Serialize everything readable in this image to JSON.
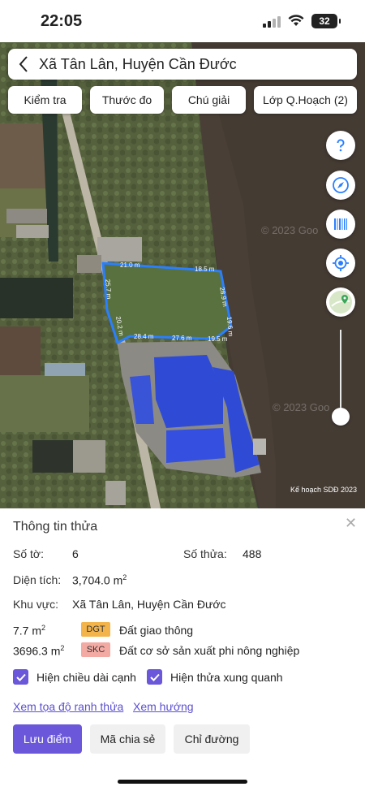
{
  "status_bar": {
    "time": "22:05",
    "battery": "32"
  },
  "header": {
    "title": "Xã Tân Lân, Huyện Cần Đước"
  },
  "map_tabs": [
    {
      "label": "Kiểm tra"
    },
    {
      "label": "Thước đo"
    },
    {
      "label": "Chú giải"
    },
    {
      "label": "Lớp Q.Hoạch (2)"
    }
  ],
  "map_tools": [
    "help-icon",
    "compass-icon",
    "barcode-icon",
    "locate-icon",
    "map-layer-icon"
  ],
  "map": {
    "watermark": "© 2023 Goo",
    "watermark2": "© 2023 Goo",
    "credit": "Kế hoạch SDĐ 2023",
    "edges": [
      "21.0 m",
      "18.5 m",
      "28.9 m",
      "19.6 m",
      "19.5 m",
      "27.6 m",
      "28.4 m",
      "20.2 m",
      "25.7 m"
    ],
    "colors": {
      "parcel_outline": "#2a7fff",
      "building": "#2f4bd6"
    }
  },
  "panel": {
    "title": "Thông tin thửa",
    "so_to_label": "Số tờ:",
    "so_to_value": "6",
    "so_thua_label": "Số thửa:",
    "so_thua_value": "488",
    "dien_tich_label": "Diện tích:",
    "dien_tich_value": "3,704.0",
    "dien_tich_unit": "m",
    "dien_tich_sup": "2",
    "khu_vuc_label": "Khu vực:",
    "khu_vuc_value": "Xã Tân Lân, Huyện Cần Đước",
    "land_uses": [
      {
        "area": "7.7",
        "unit": "m",
        "sup": "2",
        "code": "DGT",
        "name": "Đất giao thông",
        "color": "#f3b44b"
      },
      {
        "area": "3696.3",
        "unit": "m",
        "sup": "2",
        "code": "SKC",
        "name": "Đất cơ sở sản xuất phi nông nghiệp",
        "color": "#f2aaa3"
      }
    ],
    "checkboxes": [
      {
        "label": "Hiện chiều dài cạnh",
        "checked": true
      },
      {
        "label": "Hiện thửa xung quanh",
        "checked": true
      }
    ],
    "links": {
      "coords": "Xem tọa độ ranh thửa",
      "direction": "Xem hướng"
    },
    "buttons": {
      "save": "Lưu điểm",
      "share": "Mã chia sẻ",
      "route": "Chỉ đường"
    }
  }
}
